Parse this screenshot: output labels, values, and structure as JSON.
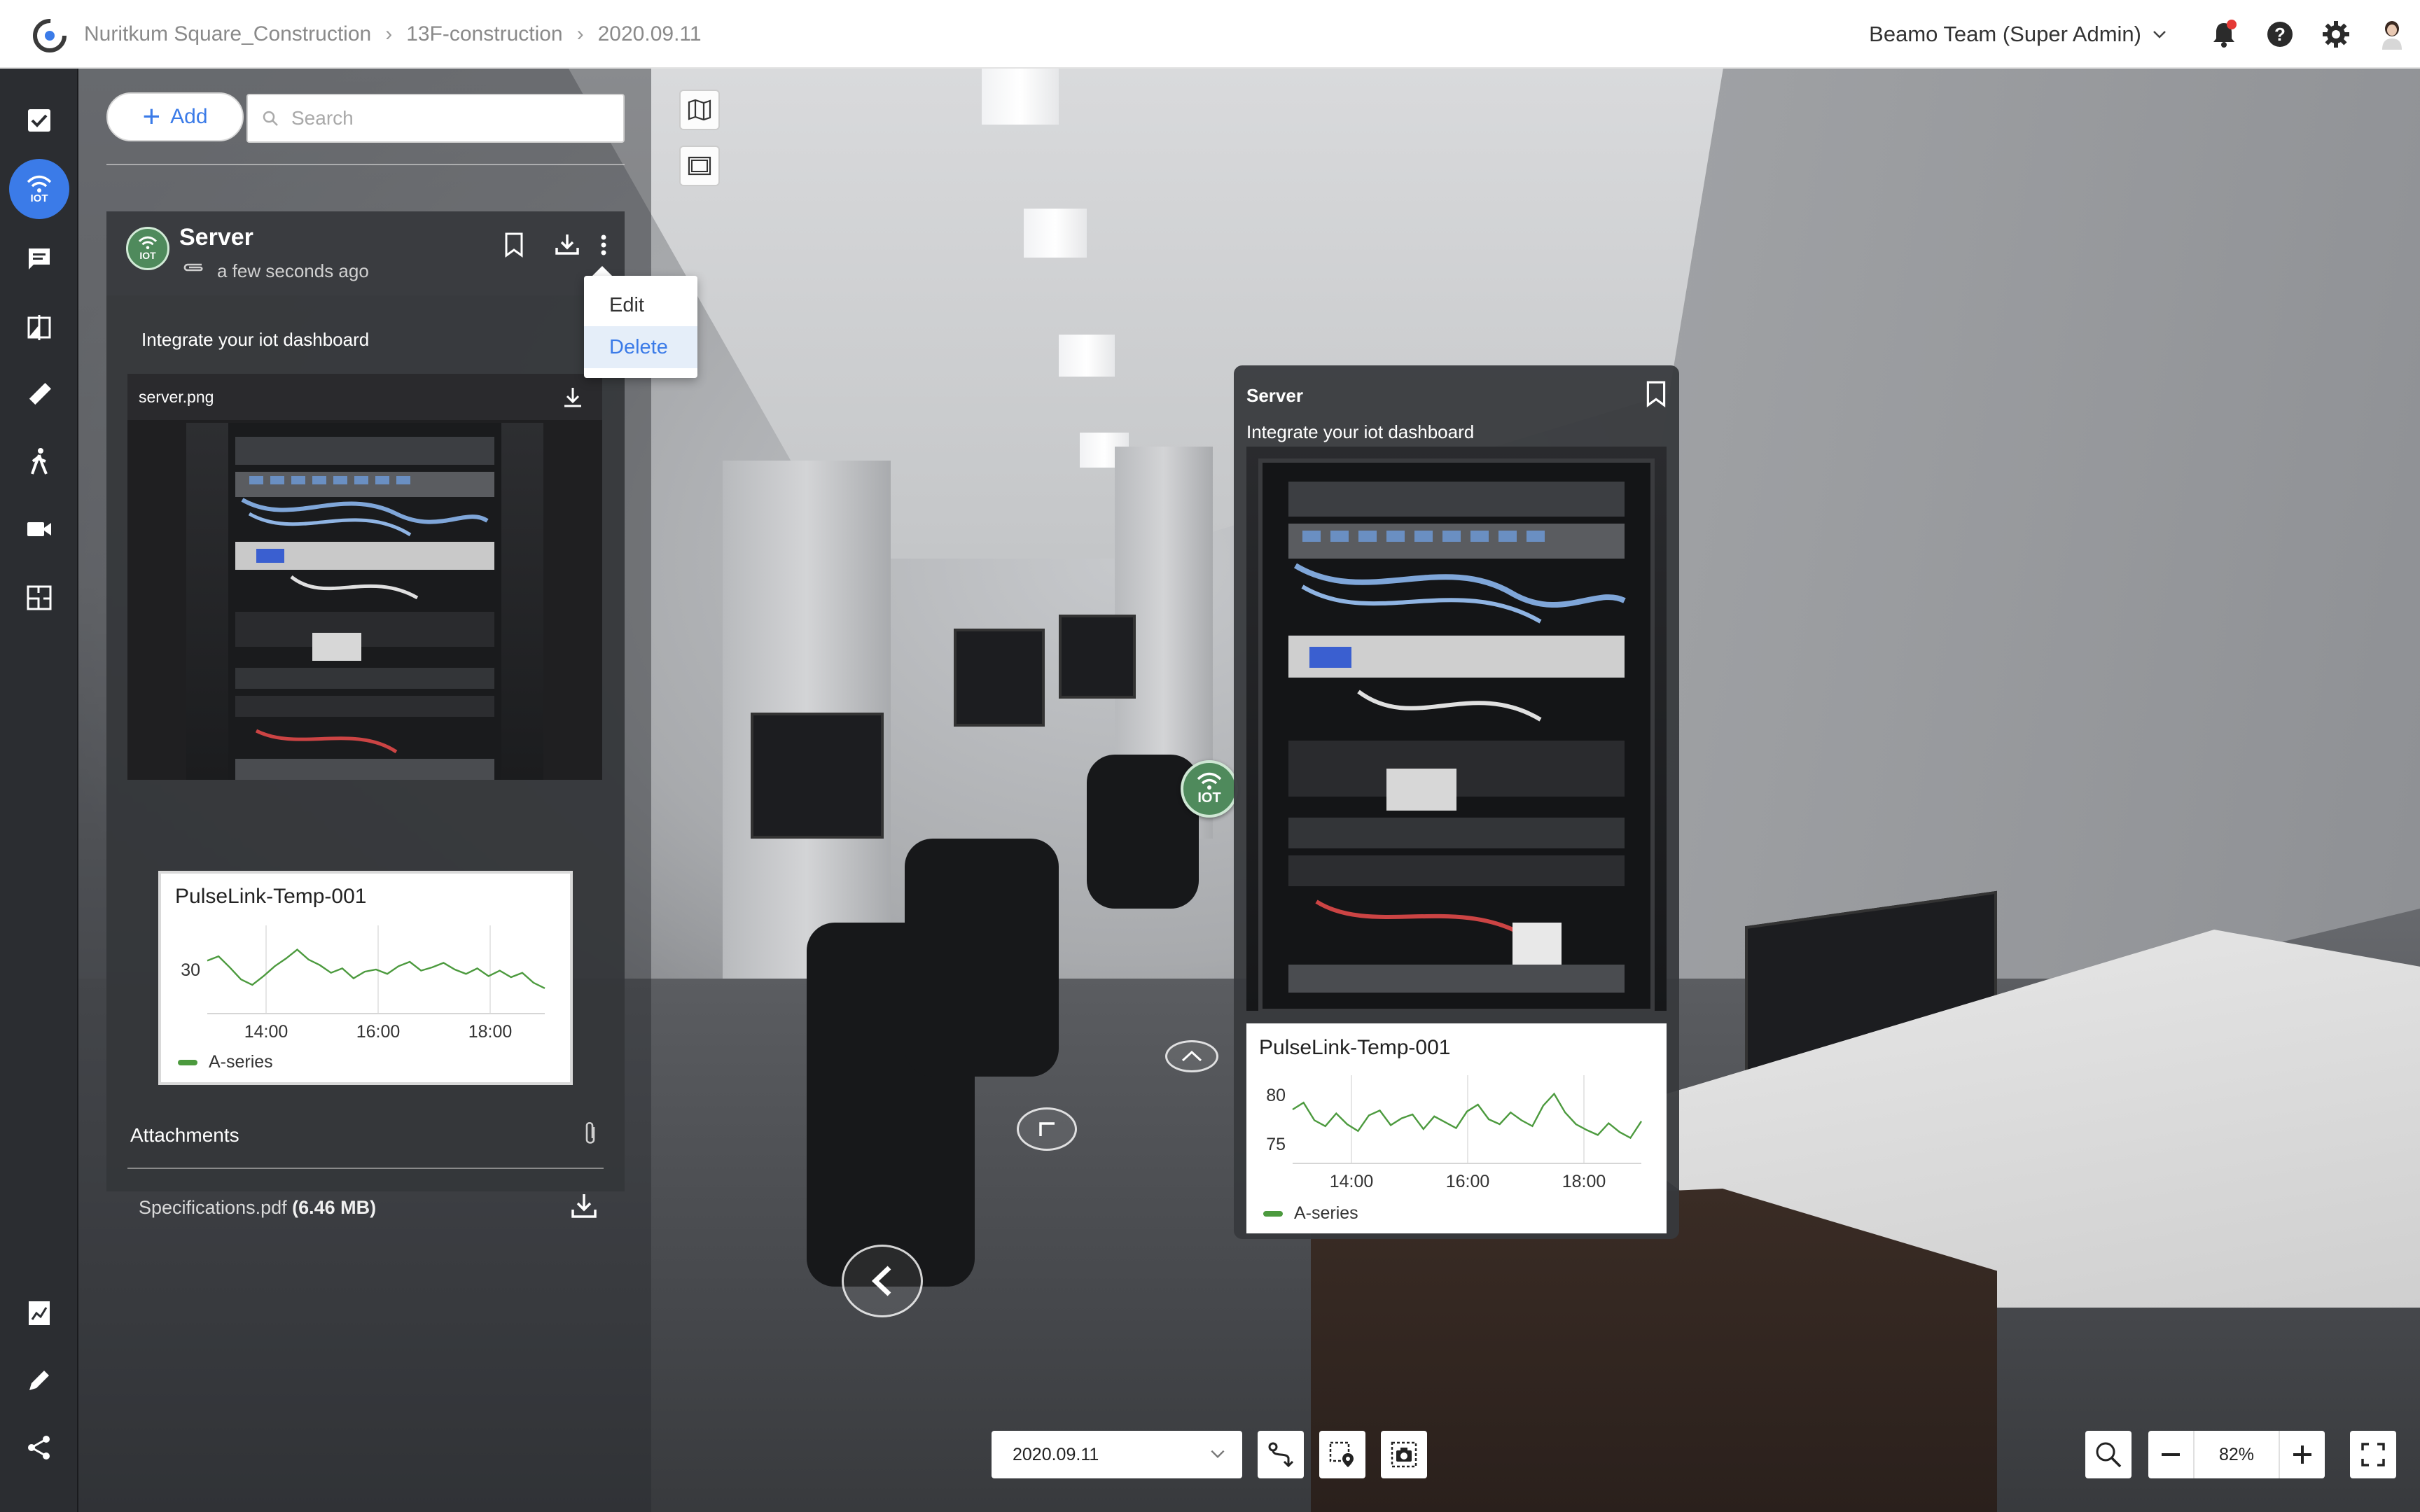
{
  "breadcrumb": {
    "items": [
      "Nuritkum Square_Construction",
      "13F-construction",
      "2020.09.11"
    ]
  },
  "header": {
    "team_label": "Beamo Team (Super Admin)"
  },
  "rail": {
    "active_label": "IOT"
  },
  "panel": {
    "add_label": "Add",
    "search_placeholder": "Search"
  },
  "card": {
    "badge": "IOT",
    "title": "Server",
    "time": "a few seconds ago",
    "description": "Integrate your iot dashboard",
    "image_name": "server.png",
    "menu": {
      "edit": "Edit",
      "delete": "Delete"
    },
    "attachments_title": "Attachments",
    "file_name": "Specifications.pdf",
    "file_size": "(6.46 MB)"
  },
  "popup": {
    "title": "Server",
    "description": "Integrate your iot dashboard"
  },
  "hotspot": {
    "label": "IOT"
  },
  "bottom": {
    "date": "2020.09.11",
    "zoom": "82%"
  },
  "colors": {
    "accent": "#3b7be8",
    "iot_green": "#4f8a5c",
    "series_green": "#4c9a3e"
  },
  "chart_data": [
    {
      "type": "line",
      "title": "PulseLink-Temp-001",
      "x_ticks": [
        "14:00",
        "16:00",
        "18:00"
      ],
      "y_ticks": [
        30
      ],
      "ylim": [
        26,
        34
      ],
      "series": [
        {
          "name": "A-series",
          "values": [
            30.8,
            31.2,
            30.2,
            29.1,
            28.6,
            29.4,
            30.3,
            31.0,
            31.8,
            30.9,
            30.4,
            29.7,
            30.1,
            29.2,
            29.8,
            30.0,
            29.6,
            30.3,
            30.7,
            29.9,
            30.2,
            30.6,
            30.0,
            29.6,
            30.1,
            29.4,
            29.9,
            29.3,
            29.7,
            28.8,
            28.3
          ]
        }
      ],
      "legend": "bottom-left"
    },
    {
      "type": "line",
      "title": "PulseLink-Temp-001",
      "x_ticks": [
        "14:00",
        "16:00",
        "18:00"
      ],
      "y_ticks": [
        75,
        80
      ],
      "ylim": [
        73,
        82
      ],
      "series": [
        {
          "name": "A-series",
          "values": [
            78.5,
            79.2,
            77.4,
            76.8,
            78.1,
            77.0,
            76.3,
            77.9,
            78.4,
            76.9,
            77.6,
            78.0,
            76.5,
            77.8,
            77.2,
            76.6,
            78.3,
            79.0,
            77.5,
            77.0,
            78.2,
            77.4,
            76.8,
            78.9,
            80.1,
            78.2,
            77.0,
            76.4,
            75.9,
            77.1,
            76.2,
            75.6,
            77.3
          ]
        }
      ],
      "legend": "bottom-left"
    }
  ]
}
